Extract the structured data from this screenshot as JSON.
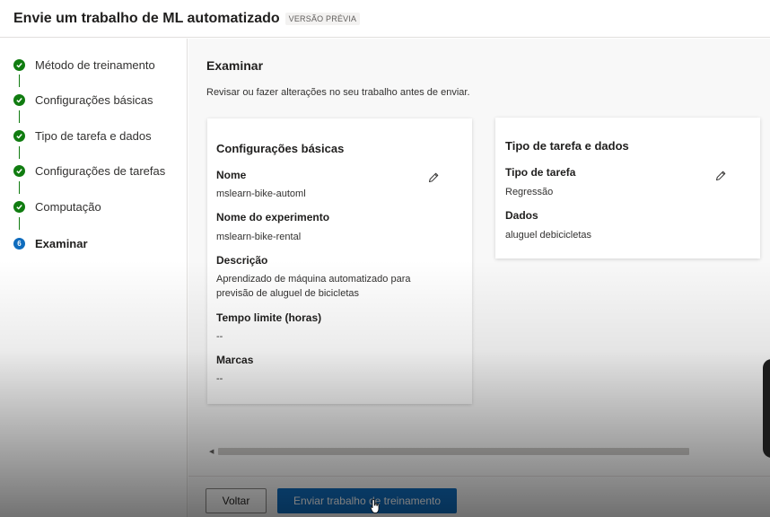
{
  "header": {
    "title": "Envie um trabalho de ML automatizado",
    "badge": "VERSÃO PRÉVIA"
  },
  "steps": [
    {
      "label": "Método de treinamento",
      "status": "complete",
      "icon": "check-circle-icon"
    },
    {
      "label": "Configurações básicas",
      "status": "complete",
      "icon": "check-circle-icon"
    },
    {
      "label": "Tipo de tarefa e dados",
      "status": "complete",
      "icon": "check-circle-icon"
    },
    {
      "label": "Configurações de tarefas",
      "status": "complete",
      "icon": "check-circle-icon"
    },
    {
      "label": "Computação",
      "status": "complete",
      "icon": "check-circle-icon"
    },
    {
      "label": "Examinar",
      "status": "current",
      "number": "6"
    }
  ],
  "main": {
    "title": "Examinar",
    "subtitle": "Revisar ou fazer alterações no seu trabalho antes de enviar."
  },
  "basic_card": {
    "title": "Configurações básicas",
    "fields": [
      {
        "label": "Nome",
        "value": "mslearn-bike-automl"
      },
      {
        "label": "Nome do experimento",
        "value": "mslearn-bike-rental"
      },
      {
        "label": "Descrição",
        "value_line1": "Aprendizado de máquina automatizado para",
        "value_line2": "previsão de aluguel de bicicletas"
      },
      {
        "label": "Tempo limite (horas)",
        "value": "--"
      },
      {
        "label": "Marcas",
        "value": "--"
      }
    ]
  },
  "task_card": {
    "title": "Tipo de tarefa e dados",
    "fields": [
      {
        "label": "Tipo de tarefa",
        "value": "Regressão"
      },
      {
        "label": "Dados",
        "value": "aluguel debicicletas"
      }
    ]
  },
  "footer": {
    "back_label": "Voltar",
    "submit_label": "Enviar trabalho de treinamento"
  },
  "colors": {
    "complete": "#107c10",
    "current": "#0f6cbd",
    "primary_button": "#0f6cbd"
  }
}
